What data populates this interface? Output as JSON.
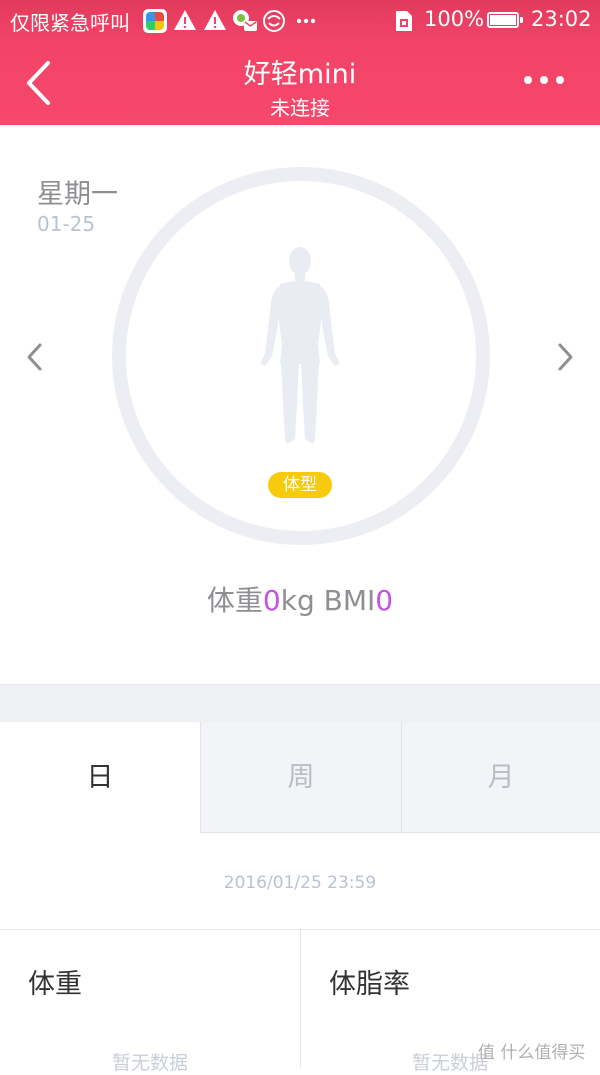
{
  "status_bar": {
    "carrier": "仅限紧急呼叫",
    "battery_percent": "100%",
    "time": "23:02",
    "icons": [
      "app-icon",
      "warning-icon",
      "warning-icon",
      "message-icon",
      "smiley-icon",
      "more-icon",
      "sim-icon",
      "battery-icon"
    ]
  },
  "header": {
    "title": "好轻mini",
    "subtitle": "未连接",
    "back_icon": "chevron-left-icon",
    "menu_icon": "more-horizontal-icon"
  },
  "summary": {
    "day_name": "星期一",
    "date": "01-25",
    "body_type_label": "体型",
    "weight_label": "体重",
    "weight_value": "0",
    "weight_unit": "kg",
    "bmi_label": "BMI",
    "bmi_value": "0"
  },
  "tabs": [
    {
      "label": "日",
      "active": true
    },
    {
      "label": "周",
      "active": false
    },
    {
      "label": "月",
      "active": false
    }
  ],
  "measurement_time": "2016/01/25 23:59",
  "stats": [
    {
      "title": "体重",
      "value": "暂无数据"
    },
    {
      "title": "体脂率",
      "value": "暂无数据"
    }
  ],
  "watermark": "值 什么值得买",
  "colors": {
    "header": "#f24468",
    "accent_value": "#c453e0",
    "badge": "#f6cb0c",
    "ring": "#eceef3"
  }
}
